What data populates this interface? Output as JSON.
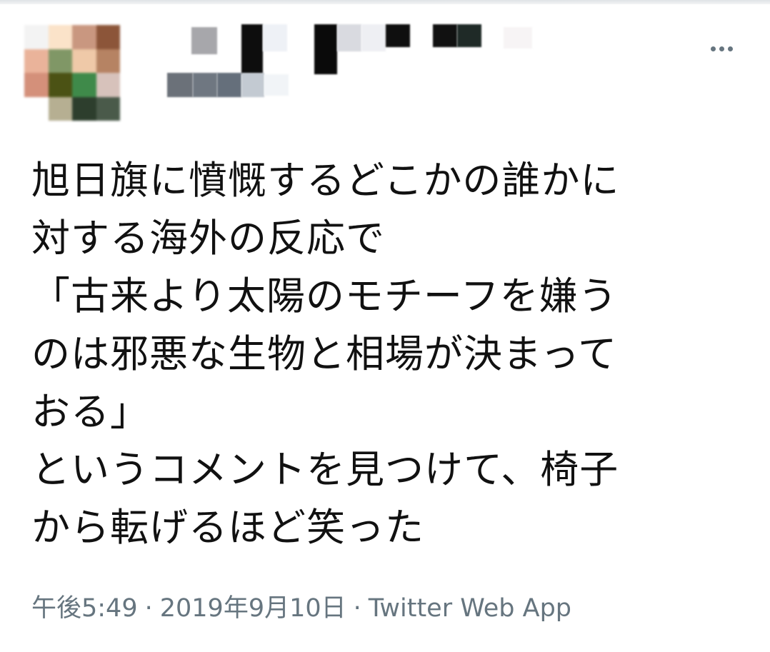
{
  "tweet": {
    "avatar_icon": "pixelated-avatar",
    "more_icon": "more-horizontal-icon",
    "text_lines": [
      "旭日旗に憤慨するどこかの誰かに",
      "対する海外の反応で",
      "「古来より太陽のモチーフを嫌う",
      "のは邪悪な生物と相場が決まって",
      "おる」",
      "というコメントを見つけて、椅子",
      "から転げるほど笑った"
    ],
    "time": "午後5:49",
    "date": "2019年9月10日",
    "separator": "·",
    "source": "Twitter Web App"
  },
  "colors": {
    "text": "#111111",
    "meta": "#66757f"
  }
}
